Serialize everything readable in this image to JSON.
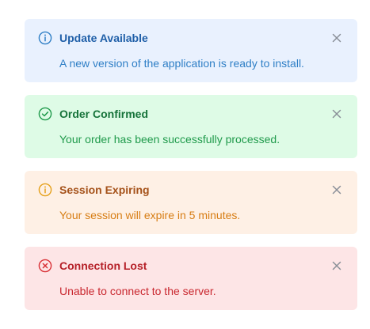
{
  "alerts": [
    {
      "type": "info",
      "icon": "info-circle-icon",
      "icon_color": "#2f7fc6",
      "title": "Update Available",
      "message": "A new version of the application is ready to install."
    },
    {
      "type": "success",
      "icon": "check-circle-icon",
      "icon_color": "#1f9a4b",
      "title": "Order Confirmed",
      "message": "Your order has been successfully processed."
    },
    {
      "type": "warning",
      "icon": "info-circle-icon",
      "icon_color": "#e5a01a",
      "title": "Session Expiring",
      "message": "Your session will expire in 5 minutes."
    },
    {
      "type": "error",
      "icon": "x-circle-icon",
      "icon_color": "#d93036",
      "title": "Connection Lost",
      "message": "Unable to connect to the server."
    }
  ],
  "close_icon": "close-icon",
  "close_color": "#8a8f98"
}
